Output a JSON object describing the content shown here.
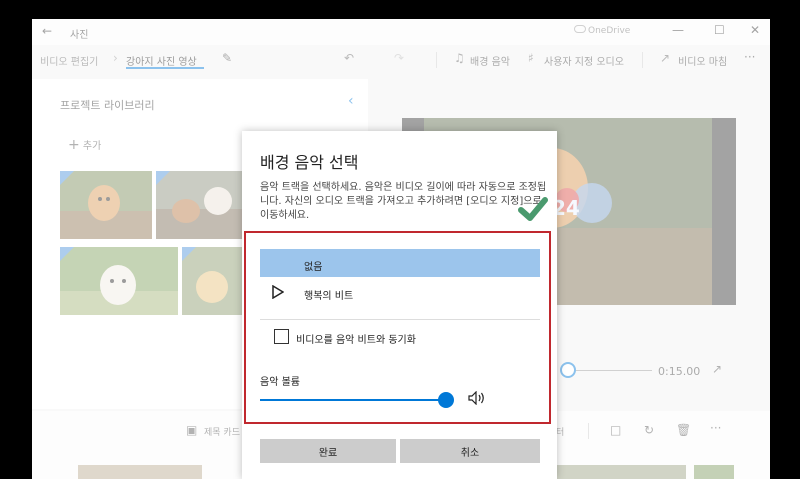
{
  "window": {
    "title": "사진",
    "onedrive": "OneDrive"
  },
  "toolbar": {
    "crumb_root": "비디오 편집기",
    "crumb_current": "강아지 사진 영상",
    "background_music": "배경 음악",
    "custom_audio": "사용자 지정 오디오",
    "finish_video": "비디오 마침",
    "more": "···"
  },
  "library": {
    "title": "프로젝트 라이브러리",
    "add": "추가"
  },
  "preview": {
    "time": "0:15.00",
    "overlay_number": "24"
  },
  "storyboard": {
    "title_card": "제목 카드",
    "filter_suffix": "터",
    "more": "···"
  },
  "dialog": {
    "title": "배경 음악 선택",
    "description": "음악 트랙을 선택하세요. 음악은 비디오 길이에 따라 자동으로 조정됩니다. 자신의 오디오 트랙을 가져오고 추가하려면 [오디오 지정]으로 이동하세요.",
    "tracks": [
      {
        "label": "없음",
        "selected": true
      },
      {
        "label": "행복의 비트",
        "selected": false
      }
    ],
    "sync_label": "비디오를 음악 비트와 동기화",
    "sync_checked": false,
    "volume_label": "음악 볼륨",
    "volume_level": 0.98,
    "ok_label": "완료",
    "cancel_label": "취소"
  },
  "colors": {
    "accent": "#0078d7",
    "selection": "#9cc5ec",
    "highlight_border": "#c0282e",
    "checkmark": "#4a9a6e"
  }
}
